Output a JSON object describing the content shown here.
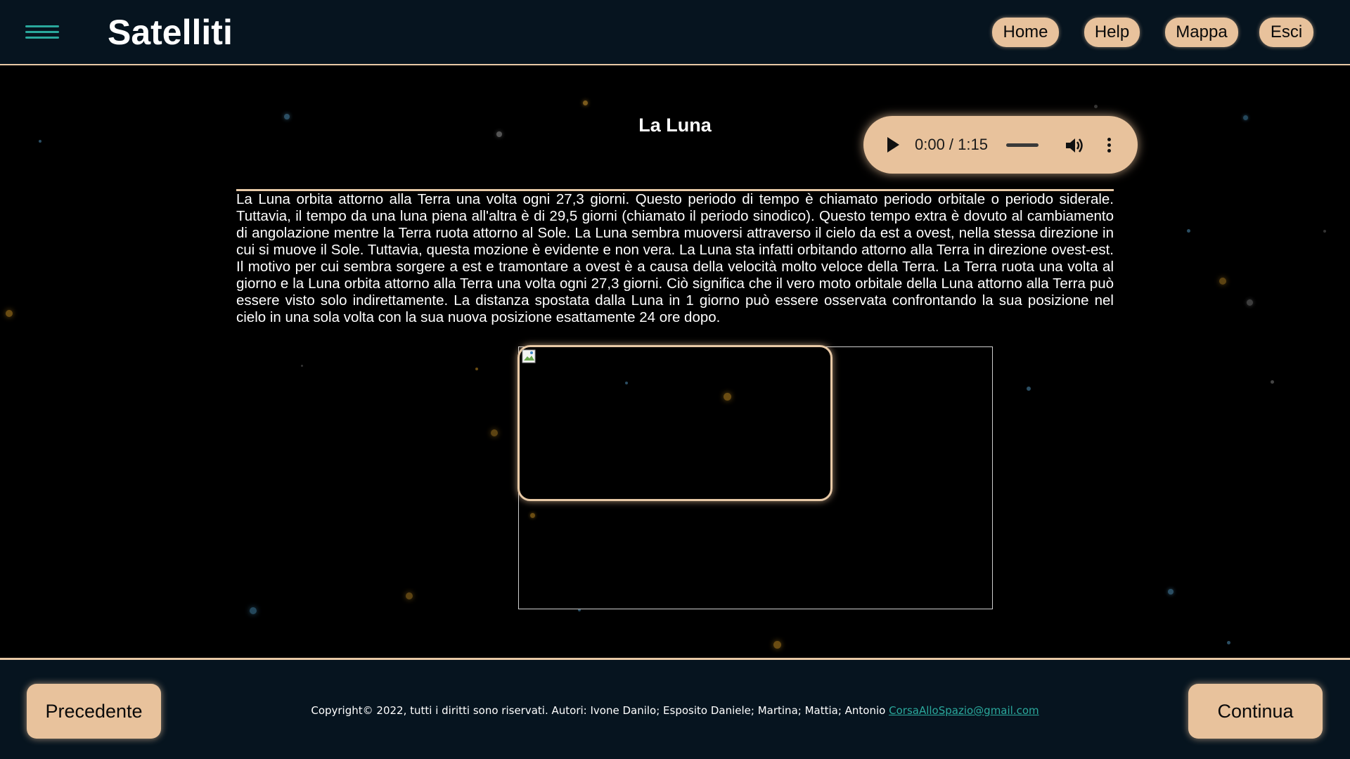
{
  "header": {
    "app_title": "Satelliti",
    "nav": {
      "home": "Home",
      "help": "Help",
      "mappa": "Mappa",
      "esci": "Esci"
    }
  },
  "main": {
    "title": "La Luna",
    "audio": {
      "time": "0:00 / 1:15"
    },
    "body_text": "La Luna orbita attorno alla Terra una volta ogni 27,3 giorni. Questo periodo di tempo è chiamato periodo orbitale o periodo siderale. Tuttavia, il tempo da una luna piena all'altra è di 29,5 giorni (chiamato il periodo sinodico). Questo tempo extra è dovuto al cambiamento di angolazione mentre la Terra ruota attorno al Sole. La Luna sembra muoversi attraverso il cielo da est a ovest, nella stessa direzione in cui si muove il Sole. Tuttavia, questa mozione è evidente e non vera. La Luna sta infatti orbitando attorno alla Terra in direzione ovest-est. Il motivo per cui sembra sorgere a est e tramontare a ovest è a causa della velocità molto veloce della Terra. La Terra ruota una volta al giorno e la Luna orbita attorno alla Terra una volta ogni 27,3 giorni. Ciò significa che il vero moto orbitale della Luna attorno alla Terra può essere visto solo indirettamente. La distanza spostata dalla Luna in 1 giorno può essere osservata confrontando la sua posizione nel cielo in una sola volta con la sua nuova posizione esattamente 24 ore dopo."
  },
  "footer": {
    "prev_label": "Precedente",
    "next_label": "Continua",
    "copyright_text": "Copyright© 2022, tutti i diritti sono riservati. Autori: Ivone Danilo; Esposito Daniele; Martina; Mattia; Antonio",
    "email": "CorsaAlloSpazio@gmail.com"
  },
  "icons": {
    "menu": "hamburger-menu-icon",
    "play": "play-icon",
    "volume": "volume-icon",
    "more": "more-options-icon",
    "broken_image": "broken-image-icon"
  },
  "colors": {
    "accent": "#e8c29c",
    "header_bg": "#06141f",
    "teal": "#2aa89c",
    "background": "#000000"
  }
}
